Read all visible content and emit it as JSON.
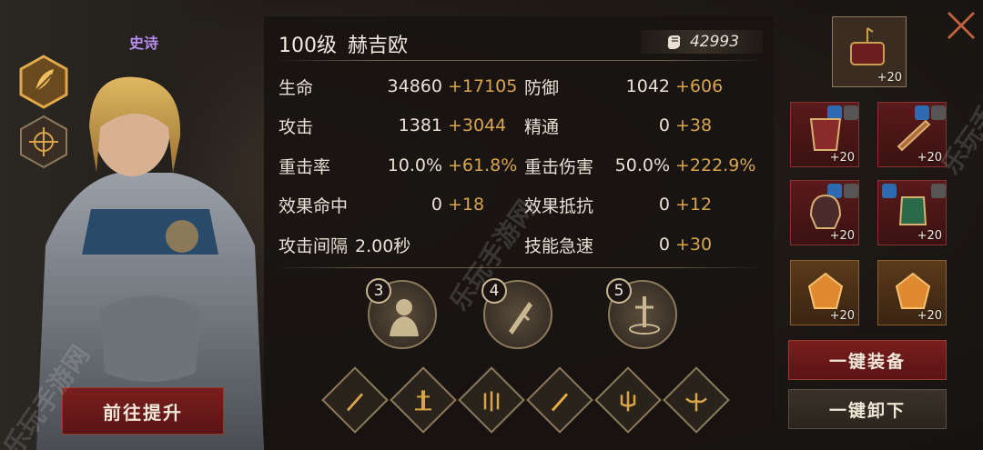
{
  "hero": {
    "rarity": "史诗",
    "level_label": "100级",
    "name": "赫吉欧",
    "power": "42993",
    "upgrade_button": "前往提升"
  },
  "stats": [
    {
      "label": "生命",
      "base": "34860",
      "bonus": "+17105"
    },
    {
      "label": "防御",
      "base": "1042",
      "bonus": "+606"
    },
    {
      "label": "攻击",
      "base": "1381",
      "bonus": "+3044"
    },
    {
      "label": "精通",
      "base": "0",
      "bonus": "+38"
    },
    {
      "label": "重击率",
      "base": "10.0%",
      "bonus": "+61.8%"
    },
    {
      "label": "重击伤害",
      "base": "50.0%",
      "bonus": "+222.9%"
    },
    {
      "label": "效果命中",
      "base": "0",
      "bonus": "+18"
    },
    {
      "label": "效果抵抗",
      "base": "0",
      "bonus": "+12"
    },
    {
      "label": "攻击间隔",
      "base": "2.00秒",
      "bonus": ""
    },
    {
      "label": "技能急速",
      "base": "0",
      "bonus": "+30"
    }
  ],
  "skills": [
    {
      "number": "3",
      "icon": "hero-portrait-skill-icon"
    },
    {
      "number": "4",
      "icon": "sword-burst-skill-icon"
    },
    {
      "number": "5",
      "icon": "sword-cage-skill-icon"
    }
  ],
  "traits": [
    {
      "icon": "sword-icon"
    },
    {
      "icon": "sword-pedestal-icon"
    },
    {
      "icon": "triple-sword-icon"
    },
    {
      "icon": "golden-sword-icon"
    },
    {
      "icon": "trident-sword-icon"
    },
    {
      "icon": "winged-sword-icon"
    }
  ],
  "equipment": {
    "artifact_level": "+20",
    "slots": [
      {
        "name": "armor",
        "level": "+20"
      },
      {
        "name": "weapon",
        "level": "+20"
      },
      {
        "name": "helmet",
        "level": "+20"
      },
      {
        "name": "gauntlet",
        "level": "+20"
      },
      {
        "name": "gem-1",
        "level": "+20"
      },
      {
        "name": "gem-2",
        "level": "+20"
      }
    ]
  },
  "actions": {
    "equip_all": "一键装备",
    "unequip_all": "一键卸下"
  },
  "watermark": "乐玩手游网",
  "colors": {
    "bonus": "#d9a54a",
    "rarity": "#b78cf0",
    "primary_button": "#7a1e1e"
  }
}
